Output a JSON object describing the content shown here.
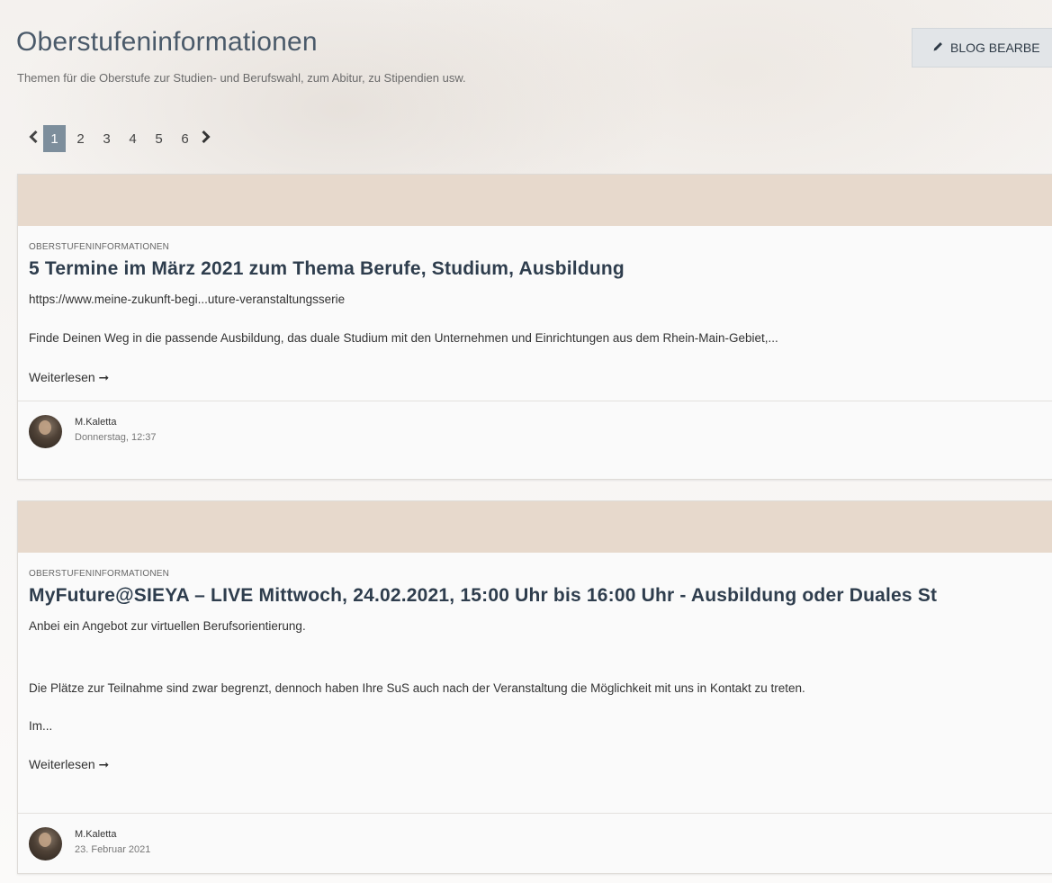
{
  "header": {
    "title": "Oberstufeninformationen",
    "subtitle": "Themen für die Oberstufe zur Studien- und Berufswahl, zum Abitur, zu Stipendien usw.",
    "edit_button_label": "BLOG BEARBE",
    "edit_icon": "pencil-icon"
  },
  "pagination": {
    "prev_icon": "chevron-left-icon",
    "next_icon": "chevron-right-icon",
    "pages": [
      "1",
      "2",
      "3",
      "4",
      "5",
      "6"
    ],
    "active_page": "1"
  },
  "posts": [
    {
      "category": "OBERSTUFENINFORMATIONEN",
      "title": "5 Termine im März 2021 zum Thema Berufe, Studium, Ausbildung",
      "paragraphs": [
        "https://www.meine-zukunft-begi...uture-veranstaltungsserie",
        "Finde Deinen Weg in die passende Ausbildung, das duale Studium mit den Unternehmen und Einrichtungen aus dem Rhein-Main-Gebiet,..."
      ],
      "read_more": "Weiterlesen ➞",
      "author": "M.Kaletta",
      "date": "Donnerstag, 12:37",
      "banner_color": "#e7d9cc"
    },
    {
      "category": "OBERSTUFENINFORMATIONEN",
      "title": "MyFuture@SIEYA – LIVE Mittwoch, 24.02.2021, 15:00 Uhr bis 16:00 Uhr - Ausbildung oder Duales St",
      "paragraphs": [
        "Anbei ein Angebot zur virtuellen Berufsorientierung.",
        "Die Plätze zur Teilnahme sind zwar begrenzt, dennoch haben Ihre SuS auch nach der Veranstaltung die Möglichkeit mit uns in Kontakt zu treten.",
        "Im..."
      ],
      "read_more": "Weiterlesen ➞",
      "author": "M.Kaletta",
      "date": "23. Februar 2021",
      "banner_color": "#e7d9cc"
    }
  ],
  "colors": {
    "title": "#4a5a6a",
    "active_page_bg": "#7d8e9c",
    "banner": "#e7d9cc",
    "post_title": "#2e3d4d"
  }
}
